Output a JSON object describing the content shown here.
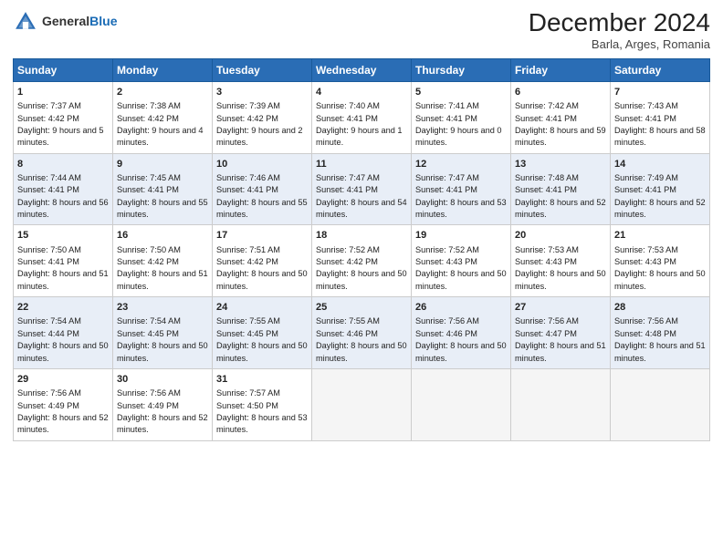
{
  "header": {
    "logo_general": "General",
    "logo_blue": "Blue",
    "title": "December 2024",
    "subtitle": "Barla, Arges, Romania"
  },
  "columns": [
    "Sunday",
    "Monday",
    "Tuesday",
    "Wednesday",
    "Thursday",
    "Friday",
    "Saturday"
  ],
  "rows": [
    [
      {
        "day": "1",
        "sunrise": "Sunrise: 7:37 AM",
        "sunset": "Sunset: 4:42 PM",
        "daylight": "Daylight: 9 hours and 5 minutes."
      },
      {
        "day": "2",
        "sunrise": "Sunrise: 7:38 AM",
        "sunset": "Sunset: 4:42 PM",
        "daylight": "Daylight: 9 hours and 4 minutes."
      },
      {
        "day": "3",
        "sunrise": "Sunrise: 7:39 AM",
        "sunset": "Sunset: 4:42 PM",
        "daylight": "Daylight: 9 hours and 2 minutes."
      },
      {
        "day": "4",
        "sunrise": "Sunrise: 7:40 AM",
        "sunset": "Sunset: 4:41 PM",
        "daylight": "Daylight: 9 hours and 1 minute."
      },
      {
        "day": "5",
        "sunrise": "Sunrise: 7:41 AM",
        "sunset": "Sunset: 4:41 PM",
        "daylight": "Daylight: 9 hours and 0 minutes."
      },
      {
        "day": "6",
        "sunrise": "Sunrise: 7:42 AM",
        "sunset": "Sunset: 4:41 PM",
        "daylight": "Daylight: 8 hours and 59 minutes."
      },
      {
        "day": "7",
        "sunrise": "Sunrise: 7:43 AM",
        "sunset": "Sunset: 4:41 PM",
        "daylight": "Daylight: 8 hours and 58 minutes."
      }
    ],
    [
      {
        "day": "8",
        "sunrise": "Sunrise: 7:44 AM",
        "sunset": "Sunset: 4:41 PM",
        "daylight": "Daylight: 8 hours and 56 minutes."
      },
      {
        "day": "9",
        "sunrise": "Sunrise: 7:45 AM",
        "sunset": "Sunset: 4:41 PM",
        "daylight": "Daylight: 8 hours and 55 minutes."
      },
      {
        "day": "10",
        "sunrise": "Sunrise: 7:46 AM",
        "sunset": "Sunset: 4:41 PM",
        "daylight": "Daylight: 8 hours and 55 minutes."
      },
      {
        "day": "11",
        "sunrise": "Sunrise: 7:47 AM",
        "sunset": "Sunset: 4:41 PM",
        "daylight": "Daylight: 8 hours and 54 minutes."
      },
      {
        "day": "12",
        "sunrise": "Sunrise: 7:47 AM",
        "sunset": "Sunset: 4:41 PM",
        "daylight": "Daylight: 8 hours and 53 minutes."
      },
      {
        "day": "13",
        "sunrise": "Sunrise: 7:48 AM",
        "sunset": "Sunset: 4:41 PM",
        "daylight": "Daylight: 8 hours and 52 minutes."
      },
      {
        "day": "14",
        "sunrise": "Sunrise: 7:49 AM",
        "sunset": "Sunset: 4:41 PM",
        "daylight": "Daylight: 8 hours and 52 minutes."
      }
    ],
    [
      {
        "day": "15",
        "sunrise": "Sunrise: 7:50 AM",
        "sunset": "Sunset: 4:41 PM",
        "daylight": "Daylight: 8 hours and 51 minutes."
      },
      {
        "day": "16",
        "sunrise": "Sunrise: 7:50 AM",
        "sunset": "Sunset: 4:42 PM",
        "daylight": "Daylight: 8 hours and 51 minutes."
      },
      {
        "day": "17",
        "sunrise": "Sunrise: 7:51 AM",
        "sunset": "Sunset: 4:42 PM",
        "daylight": "Daylight: 8 hours and 50 minutes."
      },
      {
        "day": "18",
        "sunrise": "Sunrise: 7:52 AM",
        "sunset": "Sunset: 4:42 PM",
        "daylight": "Daylight: 8 hours and 50 minutes."
      },
      {
        "day": "19",
        "sunrise": "Sunrise: 7:52 AM",
        "sunset": "Sunset: 4:43 PM",
        "daylight": "Daylight: 8 hours and 50 minutes."
      },
      {
        "day": "20",
        "sunrise": "Sunrise: 7:53 AM",
        "sunset": "Sunset: 4:43 PM",
        "daylight": "Daylight: 8 hours and 50 minutes."
      },
      {
        "day": "21",
        "sunrise": "Sunrise: 7:53 AM",
        "sunset": "Sunset: 4:43 PM",
        "daylight": "Daylight: 8 hours and 50 minutes."
      }
    ],
    [
      {
        "day": "22",
        "sunrise": "Sunrise: 7:54 AM",
        "sunset": "Sunset: 4:44 PM",
        "daylight": "Daylight: 8 hours and 50 minutes."
      },
      {
        "day": "23",
        "sunrise": "Sunrise: 7:54 AM",
        "sunset": "Sunset: 4:45 PM",
        "daylight": "Daylight: 8 hours and 50 minutes."
      },
      {
        "day": "24",
        "sunrise": "Sunrise: 7:55 AM",
        "sunset": "Sunset: 4:45 PM",
        "daylight": "Daylight: 8 hours and 50 minutes."
      },
      {
        "day": "25",
        "sunrise": "Sunrise: 7:55 AM",
        "sunset": "Sunset: 4:46 PM",
        "daylight": "Daylight: 8 hours and 50 minutes."
      },
      {
        "day": "26",
        "sunrise": "Sunrise: 7:56 AM",
        "sunset": "Sunset: 4:46 PM",
        "daylight": "Daylight: 8 hours and 50 minutes."
      },
      {
        "day": "27",
        "sunrise": "Sunrise: 7:56 AM",
        "sunset": "Sunset: 4:47 PM",
        "daylight": "Daylight: 8 hours and 51 minutes."
      },
      {
        "day": "28",
        "sunrise": "Sunrise: 7:56 AM",
        "sunset": "Sunset: 4:48 PM",
        "daylight": "Daylight: 8 hours and 51 minutes."
      }
    ],
    [
      {
        "day": "29",
        "sunrise": "Sunrise: 7:56 AM",
        "sunset": "Sunset: 4:49 PM",
        "daylight": "Daylight: 8 hours and 52 minutes."
      },
      {
        "day": "30",
        "sunrise": "Sunrise: 7:56 AM",
        "sunset": "Sunset: 4:49 PM",
        "daylight": "Daylight: 8 hours and 52 minutes."
      },
      {
        "day": "31",
        "sunrise": "Sunrise: 7:57 AM",
        "sunset": "Sunset: 4:50 PM",
        "daylight": "Daylight: 8 hours and 53 minutes."
      },
      null,
      null,
      null,
      null
    ]
  ]
}
